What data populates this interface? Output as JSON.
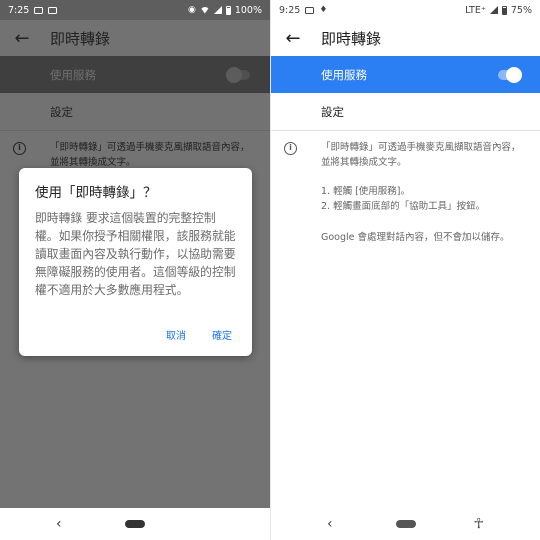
{
  "left": {
    "status": {
      "time": "7:25",
      "battery": "100%"
    },
    "toolbar": {
      "title": "即時轉錄"
    },
    "use_service": {
      "label": "使用服務"
    },
    "settings": {
      "label": "設定"
    },
    "description": {
      "line1": "「即時轉錄」可透過手機麥克風擷取語音內容，",
      "line2": "並將其轉換成文字。"
    },
    "dialog": {
      "title": "使用「即時轉錄」？",
      "body": "即時轉錄 要求這個裝置的完整控制權。如果你授予相關權限，該服務就能讀取畫面內容及執行動作，以協助需要無障礙服務的使用者。這個等級的控制權不適用於大多數應用程式。",
      "cancel": "取消",
      "confirm": "確定"
    }
  },
  "right": {
    "status": {
      "time": "9:25",
      "network": "LTE⁺",
      "battery": "75%"
    },
    "toolbar": {
      "title": "即時轉錄"
    },
    "use_service": {
      "label": "使用服務"
    },
    "settings": {
      "label": "設定"
    },
    "description": {
      "line1": "「即時轉錄」可透過手機麥克風擷取語音內容，",
      "line2": "並將其轉換成文字。",
      "step1": "1. 輕觸 [使用服務]。",
      "step2": "2. 輕觸畫面底部的「協助工具」按鈕。",
      "note": "Google 會處理對話內容，但不會加以儲存。"
    }
  },
  "colors": {
    "accent": "#2c7ef3",
    "dialog_button": "#1a73e8",
    "scrim": "#737373"
  },
  "icons": [
    "back-arrow-icon",
    "info-icon",
    "nav-back-icon",
    "nav-home-icon",
    "accessibility-icon",
    "wifi-icon",
    "signal-icon",
    "battery-icon"
  ]
}
